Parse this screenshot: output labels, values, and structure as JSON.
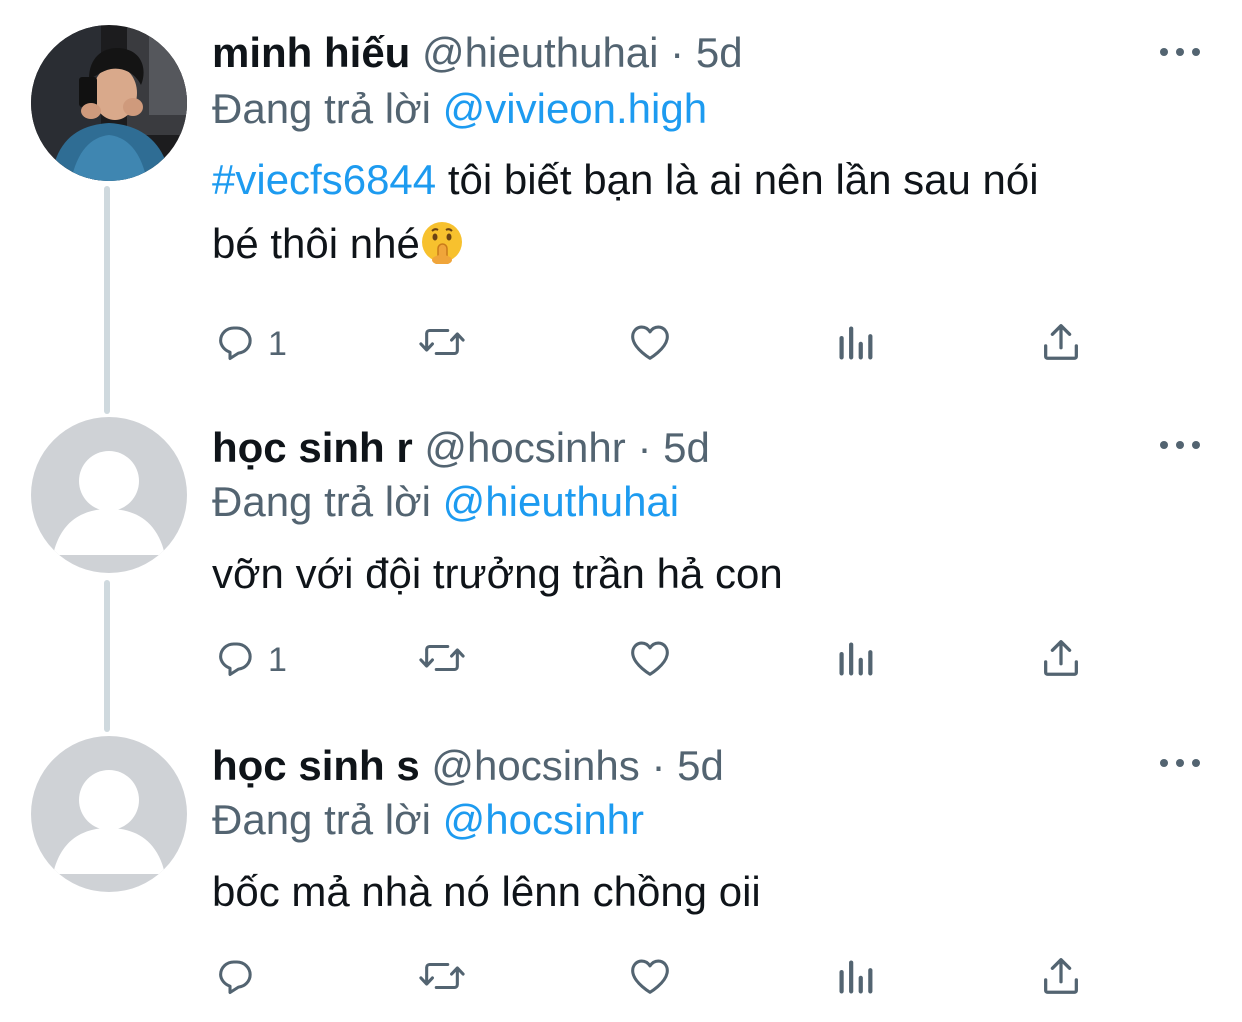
{
  "tweets": [
    {
      "name": "minh hiếu",
      "handle": "@hieuthuhai",
      "dot": "·",
      "time": "5d",
      "reply_prefix": "Đang trả lời",
      "reply_to": "@vivieon.high",
      "hashtag": "#viecfs6844",
      "text_1": " tôi biết bạn là ai nên lần sau nói",
      "text_2": "bé thôi nhé",
      "emoji": "shushing-face",
      "reply_count": "1",
      "avatar": "profile-photo"
    },
    {
      "name": "học sinh r",
      "handle": "@hocsinhr",
      "dot": "·",
      "time": "5d",
      "reply_prefix": "Đang trả lời",
      "reply_to": "@hieuthuhai",
      "text_1": "vỡn với đội trưởng trần hả con",
      "reply_count": "1",
      "avatar": "default-avatar"
    },
    {
      "name": "học sinh s",
      "handle": "@hocsinhs",
      "dot": "·",
      "time": "5d",
      "reply_prefix": "Đang trả lời",
      "reply_to": "@hocsinhr",
      "text_1": "bốc mả nhà nó lênn chồng oii",
      "reply_count": "",
      "avatar": "default-avatar"
    }
  ],
  "colors": {
    "text": "#0f1419",
    "secondary": "#536471",
    "link": "#1d9bf0",
    "thread_line": "#cfd9de",
    "avatar_placeholder_bg": "#cfd2d6"
  },
  "icons": [
    "reply-icon",
    "retweet-icon",
    "like-icon",
    "analytics-icon",
    "share-icon",
    "more-icon"
  ]
}
